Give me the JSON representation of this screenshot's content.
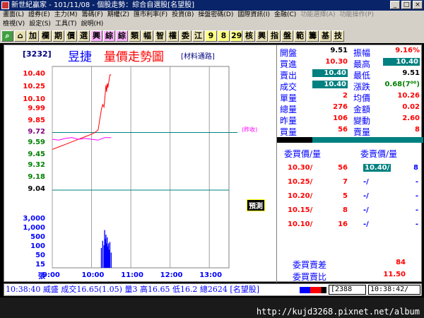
{
  "titlebar": {
    "title": "新世紀贏家 - 101/11/08 - 個股走勢：綜合自選股[名望股]",
    "buttons": [
      "_",
      "□",
      "×"
    ]
  },
  "menu": {
    "row1": [
      "畫面(L)",
      "證券(E)",
      "主力(M)",
      "籌碼(F)",
      "期權(Z)",
      "匯市利率(F)",
      "投資(B)",
      "操盤密碼(D)",
      "國際資訊(I)",
      "金融(C)",
      "功能選擇(A)",
      "功能操作(P)"
    ],
    "row2": [
      "檢視(V)",
      "設定(S)",
      "工具(T)",
      "說明(H)"
    ]
  },
  "toolbar": {
    "buttons": [
      "加",
      "欄",
      "期",
      "價",
      "選",
      "興",
      "綜",
      "綜",
      "類",
      "幅",
      "智",
      "權",
      "委",
      "江",
      "9",
      "8",
      "29",
      "核",
      "興",
      "指",
      "盤",
      "範",
      "籌",
      "基",
      "技"
    ]
  },
  "chart": {
    "stock_code": "[3232]",
    "stock_name": "昱捷",
    "title": "量價走勢圖",
    "subtitle": "[材料通路]",
    "ref_tag": "(昨收)",
    "forecast_label": "預測",
    "volume_unit": "張"
  },
  "chart_data": {
    "type": "line",
    "price_axis": {
      "ticks": [
        10.4,
        10.25,
        10.1,
        9.99,
        9.85,
        9.72,
        9.59,
        9.45,
        9.32,
        9.18,
        9.04
      ],
      "ylim": [
        9.04,
        10.4
      ],
      "reference": 9.72
    },
    "volume_axis": {
      "ticks": [
        3000,
        1000,
        500,
        100,
        50,
        15
      ],
      "scale": "log"
    },
    "x_ticks": [
      "9:00",
      "10:00",
      "11:00",
      "12:00",
      "13:00"
    ],
    "series": [
      {
        "name": "成交",
        "color": "#ff0000",
        "x": [
          "9:00",
          "9:10",
          "9:20",
          "9:30",
          "9:40",
          "9:50",
          "10:00",
          "10:05",
          "10:10",
          "10:15",
          "10:17",
          "10:19",
          "10:20",
          "10:22",
          "10:23",
          "10:24",
          "10:25",
          "10:27",
          "10:28",
          "10:30"
        ],
        "values": [
          9.52,
          9.55,
          9.58,
          9.61,
          9.64,
          9.67,
          9.7,
          9.72,
          9.75,
          9.99,
          10.05,
          10.02,
          10.1,
          10.28,
          10.2,
          10.3,
          10.25,
          10.35,
          10.4,
          10.4
        ]
      },
      {
        "name": "均價",
        "color": "#ff00ff",
        "x": [
          "9:00",
          "9:10",
          "9:20",
          "9:30",
          "9:40",
          "9:50",
          "10:00",
          "10:10",
          "10:20",
          "10:30"
        ],
        "values": [
          9.64,
          9.63,
          9.65,
          9.66,
          9.64,
          9.65,
          9.64,
          9.63,
          9.66,
          9.66
        ]
      }
    ],
    "volume": {
      "x": [
        "10:15",
        "10:17",
        "10:19",
        "10:20",
        "10:21",
        "10:22",
        "10:23",
        "10:24",
        "10:25",
        "10:26",
        "10:27",
        "10:28",
        "10:30"
      ],
      "values": [
        20,
        60,
        30,
        300,
        80,
        150,
        40,
        100,
        25,
        40,
        15,
        50,
        10
      ]
    }
  },
  "quote": {
    "rows": [
      {
        "l1": "開盤",
        "v1": "9.51",
        "c1": "blk",
        "l2": "振幅",
        "v2": "9.16%",
        "c2": "red"
      },
      {
        "l1": "買進",
        "v1": "10.30",
        "c1": "red",
        "l2": "最高",
        "v2": "10.40",
        "c2": "hl"
      },
      {
        "l1": "賣出",
        "v1": "10.40",
        "c1": "hl",
        "l2": "最低",
        "v2": "9.51",
        "c2": "blk"
      },
      {
        "l1": "成交",
        "v1": "10.40",
        "c1": "hl",
        "l2": "漲跌",
        "v2": "0.68(7⁰⁰)",
        "c2": "grn"
      },
      {
        "l1": "單量",
        "v1": "2",
        "c1": "red",
        "l2": "均價",
        "v2": "10.26",
        "c2": "red"
      },
      {
        "l1": "總量",
        "v1": "276",
        "c1": "red",
        "l2": "金額",
        "v2": "0.02",
        "c2": "red"
      },
      {
        "l1": "昨量",
        "v1": "106",
        "c1": "red",
        "l2": "變動",
        "v2": "2.60",
        "c2": "red"
      },
      {
        "l1": "買量",
        "v1": "56",
        "c1": "red",
        "l2": "賣量",
        "v2": "8",
        "c2": "red"
      }
    ],
    "order_head_buy": "委買價/量",
    "order_head_sell": "委賣價/量",
    "orders": [
      {
        "bp": "10.30/",
        "bq": "56",
        "ap": "10.40/",
        "aq": "8"
      },
      {
        "bp": "10.25/",
        "bq": "7",
        "ap": "-/",
        "aq": "-"
      },
      {
        "bp": "10.20/",
        "bq": "5",
        "ap": "-/",
        "aq": "-"
      },
      {
        "bp": "10.15/",
        "bq": "8",
        "ap": "-/",
        "aq": "-"
      },
      {
        "bp": "10.10/",
        "bq": "16",
        "ap": "-/",
        "aq": "-"
      }
    ],
    "sum_diff_label": "委買賣差",
    "sum_diff_value": "84",
    "sum_ratio_label": "委買賣比",
    "sum_ratio_value": "11.50"
  },
  "status": {
    "text": "10:38:40 威盛 成交16.65(1.05) 量3 高16.65 低16.2 總2624 [名望股]",
    "box1": "[2388",
    "box2": "10:38:42/"
  },
  "watermark": "http://kujd3268.pixnet.net/album"
}
